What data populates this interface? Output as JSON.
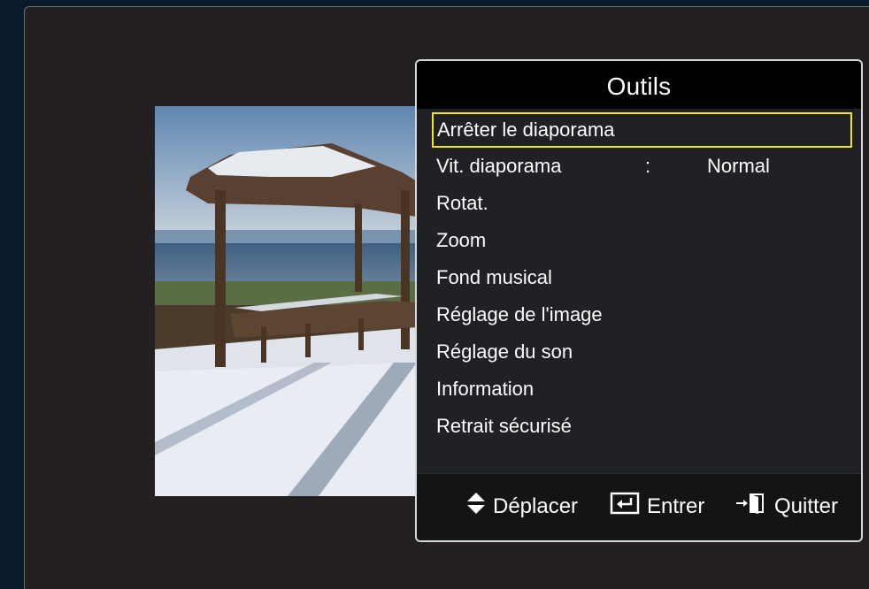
{
  "panel": {
    "title": "Outils",
    "items": [
      {
        "label": "Arrêter le diaporama",
        "selected": true
      },
      {
        "label": "Vit. diaporama",
        "separator": ":",
        "value": "Normal"
      },
      {
        "label": "Rotat."
      },
      {
        "label": "Zoom"
      },
      {
        "label": "Fond musical"
      },
      {
        "label": "Réglage de l'image"
      },
      {
        "label": "Réglage du son"
      },
      {
        "label": "Information"
      },
      {
        "label": "Retrait sécurisé"
      }
    ]
  },
  "footer": {
    "move_label": "Déplacer",
    "enter_label": "Entrer",
    "exit_label": "Quitter"
  },
  "icons": {
    "move": "up-down-arrow-icon",
    "enter": "enter-key-icon",
    "exit": "exit-door-icon"
  },
  "colors": {
    "highlight": "#f2e61c",
    "panel_bg": "#1f2124",
    "title_bg": "#000000",
    "screen_bg": "#242021",
    "outer_bg": "#0b1a2b"
  }
}
